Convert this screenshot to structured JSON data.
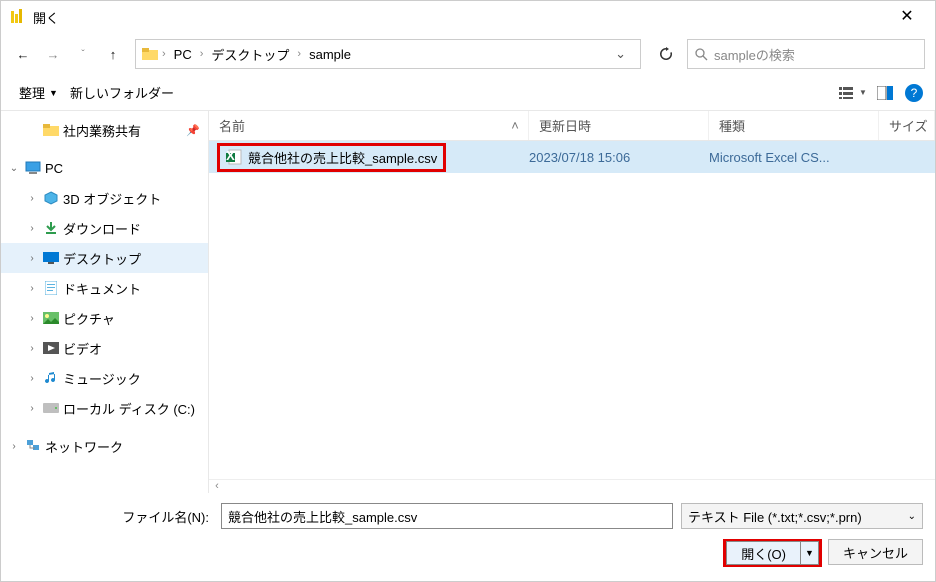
{
  "title": "開く",
  "breadcrumb": {
    "pc": "PC",
    "desktop": "デスクトップ",
    "folder": "sample"
  },
  "search": {
    "placeholder": "sampleの検索"
  },
  "toolbar": {
    "organize": "整理",
    "newfolder": "新しいフォルダー"
  },
  "sidebar": {
    "shared": "社内業務共有",
    "pc": "PC",
    "obj3d": "3D オブジェクト",
    "downloads": "ダウンロード",
    "desktop": "デスクトップ",
    "documents": "ドキュメント",
    "pictures": "ピクチャ",
    "videos": "ビデオ",
    "music": "ミュージック",
    "localdisk": "ローカル ディスク (C:)",
    "network": "ネットワーク"
  },
  "columns": {
    "name": "名前",
    "date": "更新日時",
    "type": "種類",
    "size": "サイズ"
  },
  "file": {
    "name": "競合他社の売上比較_sample.csv",
    "date": "2023/07/18 15:06",
    "type": "Microsoft Excel CS..."
  },
  "footer": {
    "filenamelabel": "ファイル名(N):",
    "filename": "競合他社の売上比較_sample.csv",
    "filetype": "テキスト File (*.txt;*.csv;*.prn)",
    "open": "開く(O)",
    "cancel": "キャンセル"
  }
}
